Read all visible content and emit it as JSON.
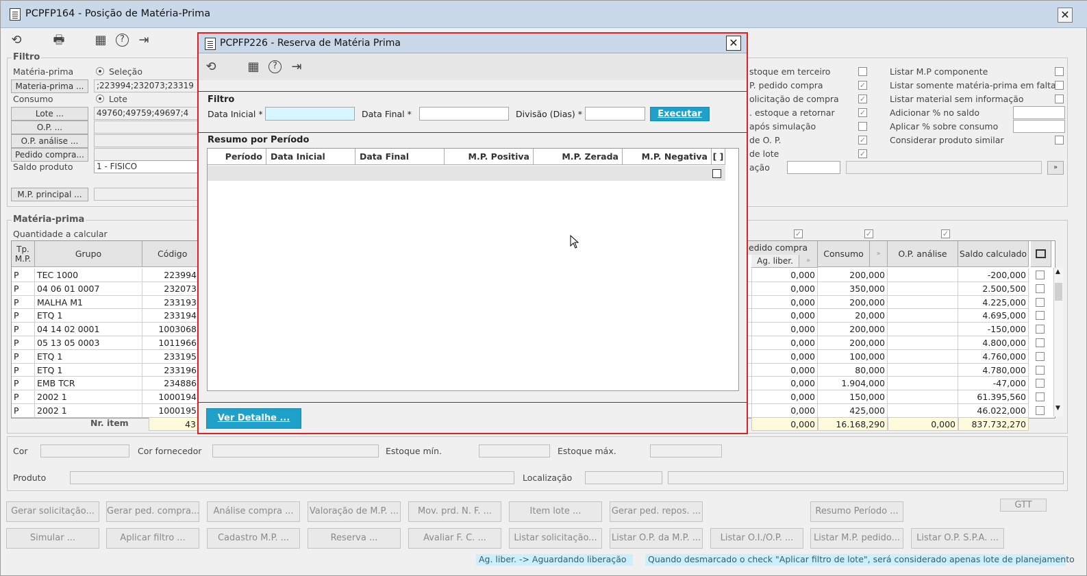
{
  "window": {
    "title": "PCPFP164 - Posição de Matéria-Prima",
    "close": "✕"
  },
  "toolbar": {
    "refresh": "⟲",
    "print": "🖶",
    "calendar": "▦",
    "help": "?",
    "exit": "⇥"
  },
  "filtro": {
    "legend": "Filtro",
    "materia_prima_label": "Matéria-prima",
    "radio_selecao": "Seleção",
    "btn_materia_prima": "Materia-prima ...",
    "materia_prima_value": ";223994;232073;23319",
    "consumo_label": "Consumo",
    "radio_lote": "Lote",
    "btn_lote": "Lote ...",
    "lote_value": "49760;49759;49697;4",
    "btn_op": "O.P. ...",
    "btn_op_analise": "O.P. análise ...",
    "btn_pedido": "Pedido compra...",
    "saldo_produto_label": "Saldo produto",
    "saldo_produto_value": "1 - FISICO",
    "btn_mp_principal": "M.P. principal ...",
    "right_col1": [
      {
        "label": "stoque em terceiro",
        "checked": false
      },
      {
        "label": "P. pedido compra",
        "checked": true
      },
      {
        "label": "olicitação de compra",
        "checked": true
      },
      {
        "label": ". estoque a retornar",
        "checked": true
      },
      {
        "label": "após simulação",
        "checked": false
      },
      {
        "label": "de O. P.",
        "checked": true
      },
      {
        "label": "de lote",
        "checked": true
      }
    ],
    "right_col1_last": "ação",
    "right_col2": [
      {
        "label": "Listar M.P componente",
        "checked": false
      },
      {
        "label": "Listar somente matéria-prima em falta",
        "checked": false
      },
      {
        "label": "Listar material sem informação",
        "checked": false
      },
      {
        "label": "Adicionar % no saldo",
        "input": true
      },
      {
        "label": "Aplicar % sobre consumo",
        "input": true
      },
      {
        "label": "Considerar produto similar",
        "checked": false
      }
    ]
  },
  "mp": {
    "legend": "Matéria-prima",
    "qtd_label": "Quantidade a calcular",
    "headers": {
      "tp": "Tp. M.P.",
      "grupo": "Grupo",
      "codigo": "Código",
      "pedido": "edido compra",
      "ag": "Ag. liber.",
      "consumo": "Consumo",
      "op_analise": "O.P. análise",
      "saldo": "Saldo calculado"
    },
    "rows": [
      {
        "tp": "P",
        "grupo": "TEC 1000",
        "codigo": "223994",
        "ag": "0,000",
        "consumo": "200,000",
        "saldo": "-200,000"
      },
      {
        "tp": "P",
        "grupo": "04 06 01 0007",
        "codigo": "232073",
        "ag": "0,000",
        "consumo": "350,000",
        "saldo": "2.500,500"
      },
      {
        "tp": "P",
        "grupo": "MALHA M1",
        "codigo": "233193",
        "ag": "0,000",
        "consumo": "200,000",
        "saldo": "4.225,000"
      },
      {
        "tp": "P",
        "grupo": "ETQ 1",
        "codigo": "233194",
        "ag": "0,000",
        "consumo": "20,000",
        "saldo": "4.695,000"
      },
      {
        "tp": "P",
        "grupo": "04 14 02 0001",
        "codigo": "1003068",
        "ag": "0,000",
        "consumo": "200,000",
        "saldo": "-150,000"
      },
      {
        "tp": "P",
        "grupo": "05 13 05 0003",
        "codigo": "1011966",
        "ag": "0,000",
        "consumo": "200,000",
        "saldo": "4.800,000"
      },
      {
        "tp": "P",
        "grupo": "ETQ 1",
        "codigo": "233195",
        "ag": "0,000",
        "consumo": "100,000",
        "saldo": "4.760,000"
      },
      {
        "tp": "P",
        "grupo": "ETQ 1",
        "codigo": "233196",
        "ag": "0,000",
        "consumo": "80,000",
        "saldo": "4.780,000"
      },
      {
        "tp": "P",
        "grupo": "EMB TCR",
        "codigo": "234886",
        "ag": "0,000",
        "consumo": "1.904,000",
        "saldo": "-47,000"
      },
      {
        "tp": "P",
        "grupo": "2002 1",
        "codigo": "1000194",
        "ag": "0,000",
        "consumo": "150,000",
        "saldo": "61.395,560"
      },
      {
        "tp": "P",
        "grupo": "2002 1",
        "codigo": "1000195",
        "ag": "0,000",
        "consumo": "425,000",
        "saldo": "46.022,000"
      }
    ],
    "nr_item_label": "Nr. item",
    "nr_item_value": "43",
    "totals": {
      "ag": "0,000",
      "consumo": "16.168,290",
      "op_analise": "0,000",
      "saldo": "837.732,270"
    }
  },
  "details": {
    "cor": "Cor",
    "cor_fornecedor": "Cor fornecedor",
    "estoque_min": "Estoque mín.",
    "estoque_max": "Estoque máx.",
    "produto": "Produto",
    "localizacao": "Localização"
  },
  "buttons_row1": [
    "Gerar solicitação...",
    "Gerar ped. compra...",
    "Análise compra ...",
    "Valoração de M.P. ...",
    "Mov. prd. N. F. ...",
    "Item lote ...",
    "Gerar ped. repos. ...",
    "Resumo Período ..."
  ],
  "btn_gtt": "GTT",
  "buttons_row2": [
    "Simular ...",
    "Aplicar filtro ...",
    "Cadastro M.P. ...",
    "Reserva ...",
    "Avaliar F. C. ...",
    "Listar solicitação...",
    "Listar O.P. da M.P. ...",
    "Listar O.I./O.P. ...",
    "Listar M.P. pedido...",
    "Listar O.P. S.P.A. ..."
  ],
  "status": {
    "left": "Ag. liber. -> Aguardando liberação",
    "right": "Quando desmarcado o check \"Aplicar filtro de lote\", será considerado apenas lote de planejamento"
  },
  "dialog": {
    "title": "PCPFP226 - Reserva de Matéria Prima",
    "close": "✕",
    "filtro": "Filtro",
    "data_inicial": "Data Inicial *",
    "data_final": "Data Final *",
    "divisao": "Divisão (Dias) *",
    "executar": "Executar",
    "resumo": "Resumo por Período",
    "headers": [
      "Período",
      "Data Inicial",
      "Data Final",
      "M.P. Positiva",
      "M.P. Zerada",
      "M.P. Negativa",
      "[ ]"
    ],
    "ver_detalhe": "Ver Detalhe ..."
  },
  "colors": {
    "titlebar": "#c9d9ea",
    "accent": "#1fa0c8",
    "dialog_border": "#e02020",
    "status_bg": "#cdeffd",
    "totals_bg": "#fffadc"
  }
}
